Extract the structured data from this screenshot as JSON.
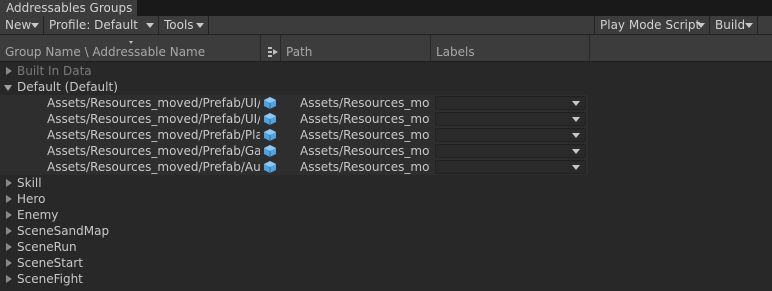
{
  "window": {
    "tab_title": "Addressables Groups"
  },
  "toolbar": {
    "new_label": "New",
    "profile_label": "Profile: Default",
    "tools_label": "Tools",
    "play_mode_label": "Play Mode Script",
    "build_label": "Build"
  },
  "columns": {
    "name": "Group Name \\ Addressable Name",
    "path": "Path",
    "labels": "Labels"
  },
  "groups_top": [
    {
      "name": "Built In Data",
      "expanded": false,
      "dim": true
    },
    {
      "name": "Default (Default)",
      "expanded": true,
      "dim": false
    }
  ],
  "entries": [
    {
      "name": "Assets/Resources_moved/Prefab/UI/UIMainView.prefab",
      "path": "Assets/Resources_moved/Prefab/UI/UIMainView.prefab",
      "label": ""
    },
    {
      "name": "Assets/Resources_moved/Prefab/UI/UIFightView.prefab",
      "path": "Assets/Resources_moved/Prefab/UI/UIFightView.prefab",
      "label": ""
    },
    {
      "name": "Assets/Resources_moved/Prefab/Player.prefab",
      "path": "Assets/Resources_moved/Prefab/Player.prefab",
      "label": ""
    },
    {
      "name": "Assets/Resources_moved/Prefab/GameManager.prefab",
      "path": "Assets/Resources_moved/Prefab/GameManager.prefab",
      "label": ""
    },
    {
      "name": "Assets/Resources_moved/Prefab/AudioManager.prefab",
      "path": "Assets/Resources_moved/Prefab/AudioManager.prefab",
      "label": ""
    }
  ],
  "groups_bottom": [
    {
      "name": "Skill"
    },
    {
      "name": "Hero"
    },
    {
      "name": "Enemy"
    },
    {
      "name": "SceneSandMap"
    },
    {
      "name": "SceneRun"
    },
    {
      "name": "SceneStart"
    },
    {
      "name": "SceneFight"
    }
  ],
  "colors": {
    "prefab_icon": "#4fa3e0",
    "background": "#282828",
    "toolbar": "#3c3c3c"
  },
  "icons": {
    "entry": "prefab-cube-icon",
    "column": "column-settings-icon"
  }
}
